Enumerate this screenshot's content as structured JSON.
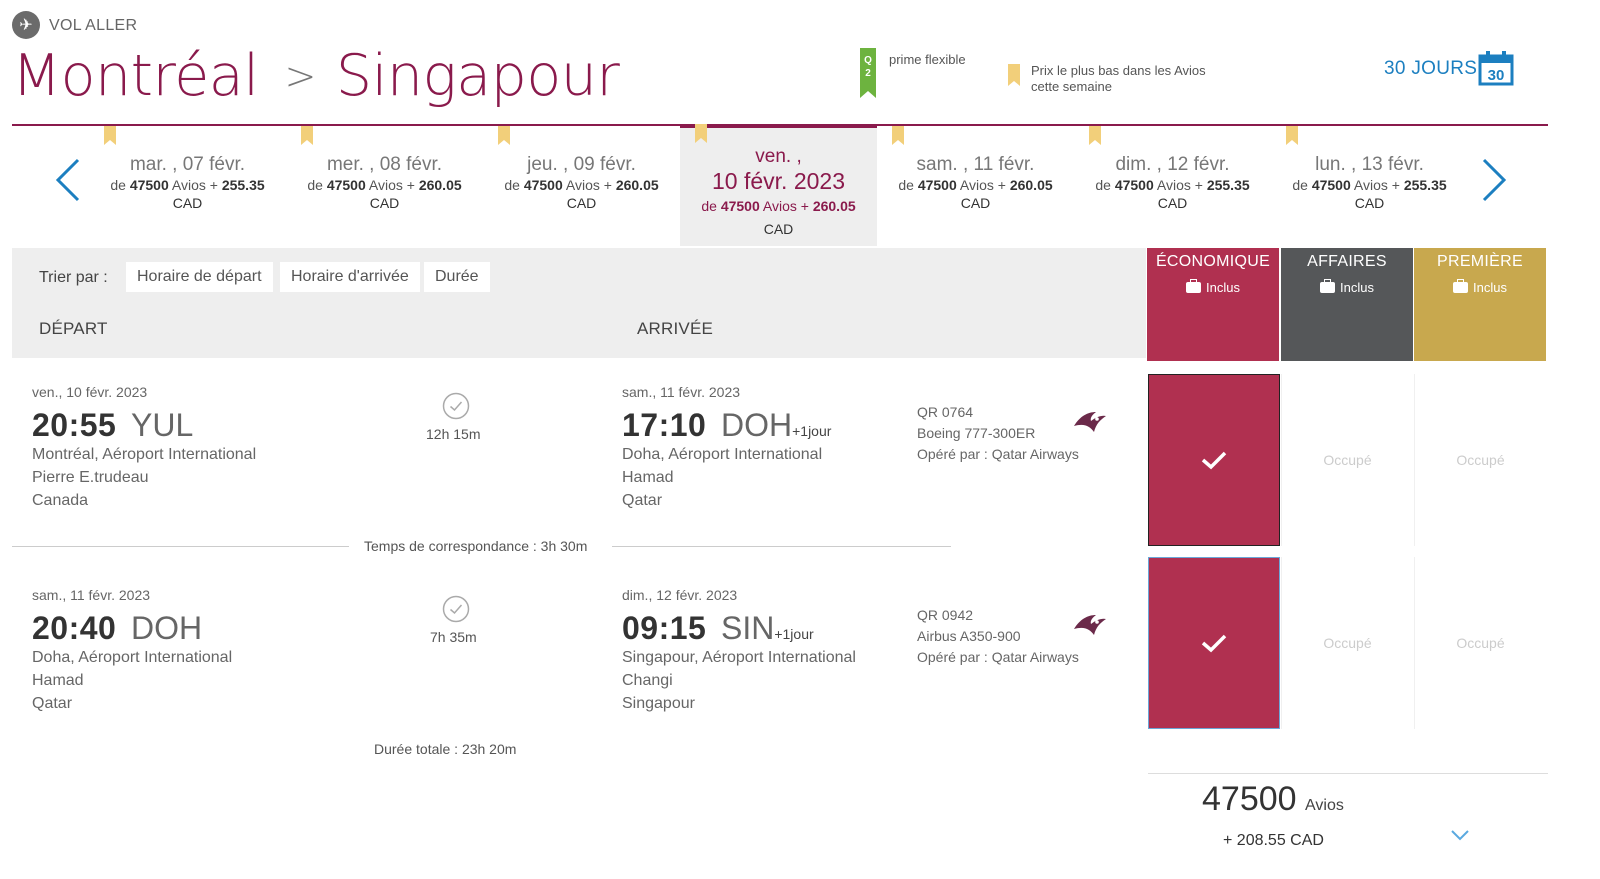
{
  "header": {
    "direction_label": "VOL ALLER",
    "origin": "Montréal",
    "separator": ">",
    "destination": "Singapour",
    "legend_q2_label": "prime flexible",
    "legend_q2_text": "Q2",
    "legend_lowest_label": "Prix le plus bas dans les Avios cette semaine",
    "days_label": "30 JOURS",
    "calendar_number": "30"
  },
  "dates": [
    {
      "day": "mar. , 07 févr.",
      "prefix": "de",
      "avios": "47500",
      "avios_word": "Avios",
      "plus": "+",
      "tax": "255.35",
      "currency": "CAD",
      "lowest": true
    },
    {
      "day": "mer. , 08 févr.",
      "prefix": "de",
      "avios": "47500",
      "avios_word": "Avios",
      "plus": "+",
      "tax": "260.05",
      "currency": "CAD",
      "lowest": true
    },
    {
      "day": "jeu. , 09 févr.",
      "prefix": "de",
      "avios": "47500",
      "avios_word": "Avios",
      "plus": "+",
      "tax": "260.05",
      "currency": "CAD",
      "lowest": true
    },
    {
      "day": "ven. ,",
      "day2": "10 févr. 2023",
      "prefix": "de",
      "avios": "47500",
      "avios_word": "Avios",
      "plus": "+",
      "tax": "260.05",
      "currency": "CAD",
      "lowest": true,
      "selected": true
    },
    {
      "day": "sam. , 11 févr.",
      "prefix": "de",
      "avios": "47500",
      "avios_word": "Avios",
      "plus": "+",
      "tax": "260.05",
      "currency": "CAD",
      "lowest": true
    },
    {
      "day": "dim. , 12 févr.",
      "prefix": "de",
      "avios": "47500",
      "avios_word": "Avios",
      "plus": "+",
      "tax": "255.35",
      "currency": "CAD",
      "lowest": true
    },
    {
      "day": "lun. , 13 févr.",
      "prefix": "de",
      "avios": "47500",
      "avios_word": "Avios",
      "plus": "+",
      "tax": "255.35",
      "currency": "CAD",
      "lowest": true
    }
  ],
  "sort": {
    "label": "Trier par :",
    "options": [
      "Horaire de départ",
      "Horaire d'arrivée",
      "Durée"
    ]
  },
  "columns": {
    "departure": "DÉPART",
    "arrival": "ARRIVÉE"
  },
  "cabins": [
    {
      "name": "ÉCONOMIQUE",
      "included": "Inclus",
      "color": "#b03050"
    },
    {
      "name": "AFFAIRES",
      "included": "Inclus",
      "color": "#555759"
    },
    {
      "name": "PREMIÈRE",
      "included": "Inclus",
      "color": "#c8a84e"
    }
  ],
  "segments": [
    {
      "dep_date": "ven., 10 févr. 2023",
      "dep_time": "20:55",
      "dep_code": "YUL",
      "dep_place": [
        "Montréal, Aéroport International",
        "Pierre E.trudeau",
        "Canada"
      ],
      "duration": "12h 15m",
      "arr_date": "sam., 11 févr. 2023",
      "arr_time": "17:10",
      "arr_code": "DOH",
      "arr_plus": "+1jour",
      "arr_place": [
        "Doha, Aéroport International",
        "Hamad",
        "Qatar"
      ],
      "flight": "QR 0764",
      "aircraft": "Boeing 777-300ER",
      "operator": "Opéré par : Qatar Airways",
      "occupied": "Occupé"
    },
    {
      "dep_date": "sam., 11 févr. 2023",
      "dep_time": "20:40",
      "dep_code": "DOH",
      "dep_place": [
        "Doha, Aéroport International",
        "Hamad",
        "Qatar"
      ],
      "duration": "7h 35m",
      "arr_date": "dim., 12 févr. 2023",
      "arr_time": "09:15",
      "arr_code": "SIN",
      "arr_plus": "+1jour",
      "arr_place": [
        "Singapour, Aéroport International",
        "Changi",
        "Singapour"
      ],
      "flight": "QR 0942",
      "aircraft": "Airbus A350-900",
      "operator": "Opéré par : Qatar Airways",
      "occupied": "Occupé"
    }
  ],
  "connection": "Temps de correspondance : 3h 30m",
  "total_duration": "Durée totale : 23h 20m",
  "price": {
    "avios": "47500",
    "avios_unit": "Avios",
    "cad": "+ 208.55 CAD"
  },
  "colors": {
    "brand": "#8a1a4c",
    "economy": "#b03050",
    "business": "#555759",
    "first": "#c8a84e",
    "link": "#1c7fc0",
    "marker": "#f2cf7a",
    "q2": "#6db33f"
  },
  "icons": {
    "plane": "plane-icon",
    "calendar": "calendar-icon",
    "check": "check-icon",
    "clock": "duration-check-icon",
    "airline": "qatar-airways-logo",
    "chevron": "chevron-down-icon"
  }
}
